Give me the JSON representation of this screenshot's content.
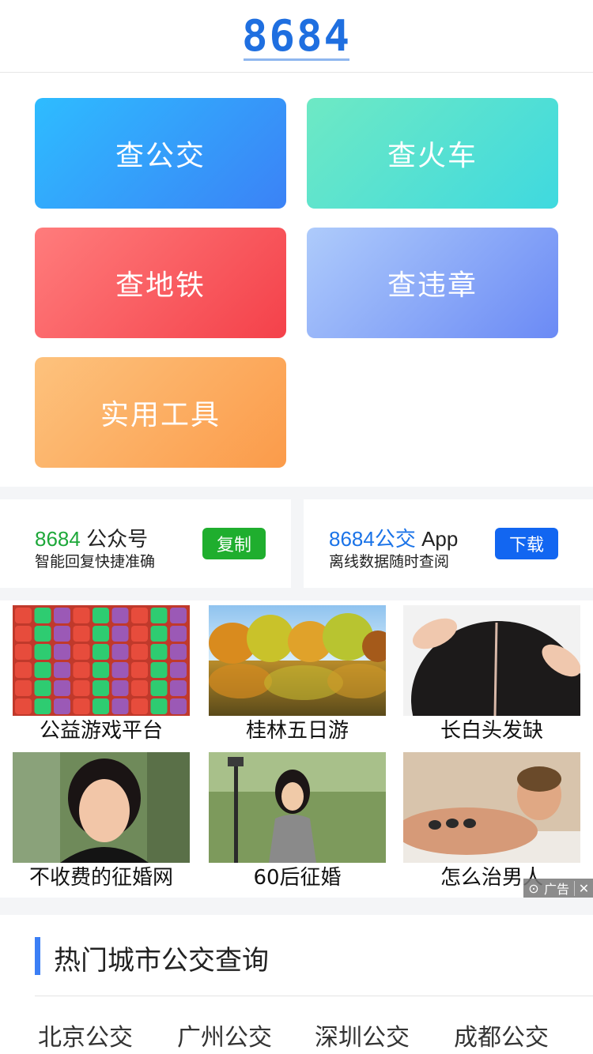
{
  "header": {
    "logo_text": "8684"
  },
  "tiles": [
    {
      "label": "查公交"
    },
    {
      "label": "查火车"
    },
    {
      "label": "查地铁"
    },
    {
      "label": "查违章"
    },
    {
      "label": "实用工具"
    }
  ],
  "promos": [
    {
      "brand": "8684",
      "title_rest": " 公众号",
      "subtitle": "智能回复快捷准确",
      "button": "复制",
      "accent": "#1ea83a"
    },
    {
      "brand": "8684公交",
      "title_rest": " App",
      "subtitle": "离线数据随时查阅",
      "button": "下载",
      "accent": "#1266f1"
    }
  ],
  "ads": {
    "items": [
      {
        "caption": "公益游戏平台",
        "image": "candy-game-grid"
      },
      {
        "caption": "桂林五日游",
        "image": "autumn-lake-trees"
      },
      {
        "caption": "长白头发缺",
        "image": "hair-scalp"
      },
      {
        "caption": "不收费的征婚网",
        "image": "woman-portrait-smiling"
      },
      {
        "caption": "60后征婚",
        "image": "woman-in-park"
      },
      {
        "caption": "怎么治男人",
        "image": "man-massage"
      }
    ],
    "badge_label": "广告"
  },
  "hot": {
    "title": "热门城市公交查询",
    "cities": [
      "北京公交",
      "广州公交",
      "深圳公交",
      "成都公交"
    ]
  }
}
